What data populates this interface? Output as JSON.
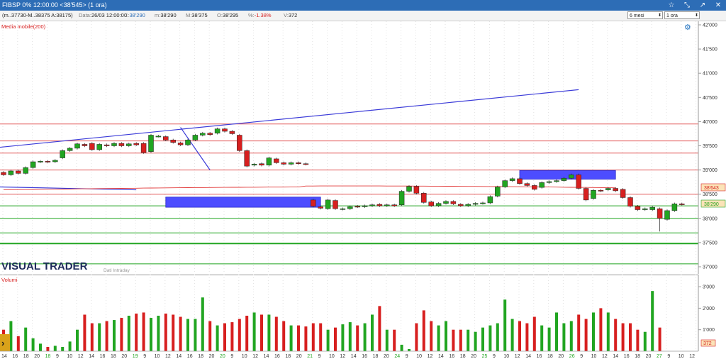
{
  "window": {
    "title": "FIBSP 0%  12:00:00  <38'545>  (1 ora)",
    "buttons": [
      "☆",
      "⤡",
      "↗",
      "✕"
    ]
  },
  "infobar": {
    "ohlc_text": "(m..37730-M..38375 A:38175)",
    "date_label": "Data:",
    "date_value": "26/03 12:00:00",
    "close_label": "C:",
    "close_value": "38'290",
    "min_label": "m:",
    "min_value": "38'290",
    "max_label": "M:",
    "max_value": "38'375",
    "open_label": "O:",
    "open_value": "38'295",
    "change_label": "%:",
    "change_value": "-1.38%",
    "volume_label": "V:",
    "volume_value": "372",
    "period_select": "6 mesi",
    "interval_select": "1 ora"
  },
  "price_pane": {
    "indicator_label": "Media mobile(200)",
    "watermark": "VISUAL TRADER",
    "subtitle": "Dati Intraday",
    "ma_badge": "38'643",
    "last_badge": "38'290",
    "y_ticks": [
      "42'000",
      "41'500",
      "41'000",
      "40'500",
      "40'000",
      "39'500",
      "39'000",
      "38'500",
      "38'000",
      "37'500",
      "37'000"
    ]
  },
  "volume_pane": {
    "label": "Volumi",
    "y_ticks": [
      "3'000",
      "2'000",
      "1'000"
    ],
    "last_badge": "372"
  },
  "x_axis": {
    "labels": [
      "14",
      "16",
      "18",
      "20",
      "18",
      "9",
      "10",
      "12",
      "14",
      "16",
      "18",
      "20",
      "19",
      "9",
      "10",
      "12",
      "14",
      "16",
      "18",
      "20",
      "20",
      "9",
      "10",
      "12",
      "14",
      "16",
      "18",
      "20",
      "21",
      "9",
      "10",
      "12",
      "14",
      "16",
      "18",
      "20",
      "24",
      "9",
      "10",
      "12",
      "14",
      "16",
      "18",
      "20",
      "25",
      "9",
      "10",
      "12",
      "14",
      "16",
      "18",
      "20",
      "26",
      "9",
      "10",
      "12",
      "14",
      "16",
      "18",
      "20",
      "27",
      "9",
      "10",
      "12"
    ],
    "day_markers": [
      "18",
      "19",
      "20",
      "21",
      "24",
      "25",
      "26",
      "27"
    ]
  },
  "colors": {
    "up": "#21a521",
    "down": "#d71f1f",
    "titlebar": "#2d6db6",
    "trendline": "#3a3ad8",
    "zone": "#4d4dff"
  },
  "chart_data": {
    "type": "candlestick",
    "ylim": [
      37000,
      42000
    ],
    "candles": [
      {
        "o": 38950,
        "c": 38900
      },
      {
        "o": 38900,
        "c": 38980
      },
      {
        "o": 38980,
        "c": 38930
      },
      {
        "o": 38930,
        "c": 39050
      },
      {
        "o": 39050,
        "c": 39170
      },
      {
        "o": 39170,
        "c": 39180
      },
      {
        "o": 39180,
        "c": 39170
      },
      {
        "o": 39170,
        "c": 39200
      },
      {
        "o": 39250,
        "c": 39400
      },
      {
        "o": 39400,
        "c": 39450
      },
      {
        "o": 39450,
        "c": 39540
      },
      {
        "o": 39530,
        "c": 39500
      },
      {
        "o": 39550,
        "c": 39420
      },
      {
        "o": 39420,
        "c": 39530
      },
      {
        "o": 39520,
        "c": 39500
      },
      {
        "o": 39500,
        "c": 39550
      },
      {
        "o": 39550,
        "c": 39500
      },
      {
        "o": 39500,
        "c": 39540
      },
      {
        "o": 39550,
        "c": 39520
      },
      {
        "o": 39550,
        "c": 39360
      },
      {
        "o": 39380,
        "c": 39720
      },
      {
        "o": 39700,
        "c": 39700
      },
      {
        "o": 39690,
        "c": 39620
      },
      {
        "o": 39620,
        "c": 39570
      },
      {
        "o": 39560,
        "c": 39520
      },
      {
        "o": 39520,
        "c": 39620
      },
      {
        "o": 39620,
        "c": 39720
      },
      {
        "o": 39720,
        "c": 39760
      },
      {
        "o": 39760,
        "c": 39730
      },
      {
        "o": 39760,
        "c": 39850
      },
      {
        "o": 39850,
        "c": 39800
      },
      {
        "o": 39800,
        "c": 39750
      },
      {
        "o": 39720,
        "c": 39400
      },
      {
        "o": 39400,
        "c": 39080
      },
      {
        "o": 39100,
        "c": 39120
      },
      {
        "o": 39130,
        "c": 39100
      },
      {
        "o": 39100,
        "c": 39250
      },
      {
        "o": 39230,
        "c": 39150
      },
      {
        "o": 39150,
        "c": 39120
      },
      {
        "o": 39120,
        "c": 39150
      },
      {
        "o": 39150,
        "c": 39130
      },
      {
        "o": 39130,
        "c": 39120
      },
      {
        "o": 38380,
        "c": 38250
      },
      {
        "o": 38240,
        "c": 38210
      },
      {
        "o": 38200,
        "c": 38380
      },
      {
        "o": 38370,
        "c": 38200
      },
      {
        "o": 38190,
        "c": 38200
      },
      {
        "o": 38200,
        "c": 38240
      },
      {
        "o": 38250,
        "c": 38240
      },
      {
        "o": 38240,
        "c": 38260
      },
      {
        "o": 38260,
        "c": 38280
      },
      {
        "o": 38290,
        "c": 38260
      },
      {
        "o": 38260,
        "c": 38280
      },
      {
        "o": 38280,
        "c": 38260
      },
      {
        "o": 38280,
        "c": 38560
      },
      {
        "o": 38560,
        "c": 38660
      },
      {
        "o": 38660,
        "c": 38520
      },
      {
        "o": 38520,
        "c": 38330
      },
      {
        "o": 38340,
        "c": 38260
      },
      {
        "o": 38260,
        "c": 38310
      },
      {
        "o": 38310,
        "c": 38350
      },
      {
        "o": 38350,
        "c": 38300
      },
      {
        "o": 38290,
        "c": 38260
      },
      {
        "o": 38260,
        "c": 38290
      },
      {
        "o": 38290,
        "c": 38310
      },
      {
        "o": 38310,
        "c": 38320
      },
      {
        "o": 38320,
        "c": 38450
      },
      {
        "o": 38460,
        "c": 38650
      },
      {
        "o": 38650,
        "c": 38780
      },
      {
        "o": 38780,
        "c": 38820
      },
      {
        "o": 38820,
        "c": 38720
      },
      {
        "o": 38720,
        "c": 38680
      },
      {
        "o": 38680,
        "c": 38600
      },
      {
        "o": 38640,
        "c": 38740
      },
      {
        "o": 38740,
        "c": 38760
      },
      {
        "o": 38760,
        "c": 38780
      },
      {
        "o": 38780,
        "c": 38830
      },
      {
        "o": 38830,
        "c": 38900
      },
      {
        "o": 38900,
        "c": 38620
      },
      {
        "o": 38620,
        "c": 38380
      },
      {
        "o": 38410,
        "c": 38580
      },
      {
        "o": 38580,
        "c": 38570
      },
      {
        "o": 38590,
        "c": 38620
      },
      {
        "o": 38620,
        "c": 38570
      },
      {
        "o": 38600,
        "c": 38430
      },
      {
        "o": 38430,
        "c": 38250
      },
      {
        "o": 38250,
        "c": 38180
      },
      {
        "o": 38180,
        "c": 38200
      },
      {
        "o": 38180,
        "c": 38230
      },
      {
        "o": 38200,
        "c": 38000
      },
      {
        "o": 37980,
        "c": 38160
      },
      {
        "o": 38160,
        "c": 38300
      },
      {
        "o": 38300,
        "c": 38290
      }
    ],
    "volumes": [
      1000,
      1400,
      700,
      1100,
      600,
      350,
      200,
      250,
      200,
      450,
      1000,
      1700,
      1300,
      1300,
      1400,
      1450,
      1550,
      1650,
      1750,
      1800,
      1550,
      1650,
      1750,
      1700,
      1600,
      1500,
      1500,
      2500,
      1400,
      1200,
      1300,
      1350,
      1500,
      1650,
      1800,
      1700,
      1700,
      1600,
      1400,
      1200,
      1200,
      1150,
      1300,
      1300,
      1000,
      1100,
      1250,
      1350,
      1200,
      1300,
      1700,
      2100,
      1000,
      1000,
      300,
      100,
      1300,
      1900,
      1400,
      1200,
      1400,
      1000,
      1000,
      1000,
      900,
      1100,
      1200,
      1300,
      2400,
      1500,
      1400,
      1300,
      1600,
      1200,
      1100,
      1800,
      1300,
      1400,
      1700,
      1500,
      1800,
      2000,
      1800,
      1500,
      1300,
      1300,
      1000,
      900,
      2800,
      1100
    ],
    "trendlines": [
      {
        "name": "upper-trendline",
        "from": {
          "i": 0,
          "y": 39470
        },
        "to": {
          "i": 78,
          "y": 40660
        }
      },
      {
        "name": "lower-trendline",
        "from": {
          "i": 0,
          "y": 38650
        },
        "to": {
          "i": 18,
          "y": 38590
        }
      }
    ],
    "horizontal_lines_red": [
      39950,
      39600,
      39350,
      39000,
      38500
    ],
    "horizontal_lines_green": [
      38260,
      38000,
      37700,
      37480,
      37060
    ],
    "zones": [
      {
        "x0": 22,
        "x1": 43,
        "y0": 38230,
        "y1": 38440
      },
      {
        "x0": 70,
        "x1": 83,
        "y0": 38810,
        "y1": 38990
      }
    ]
  }
}
